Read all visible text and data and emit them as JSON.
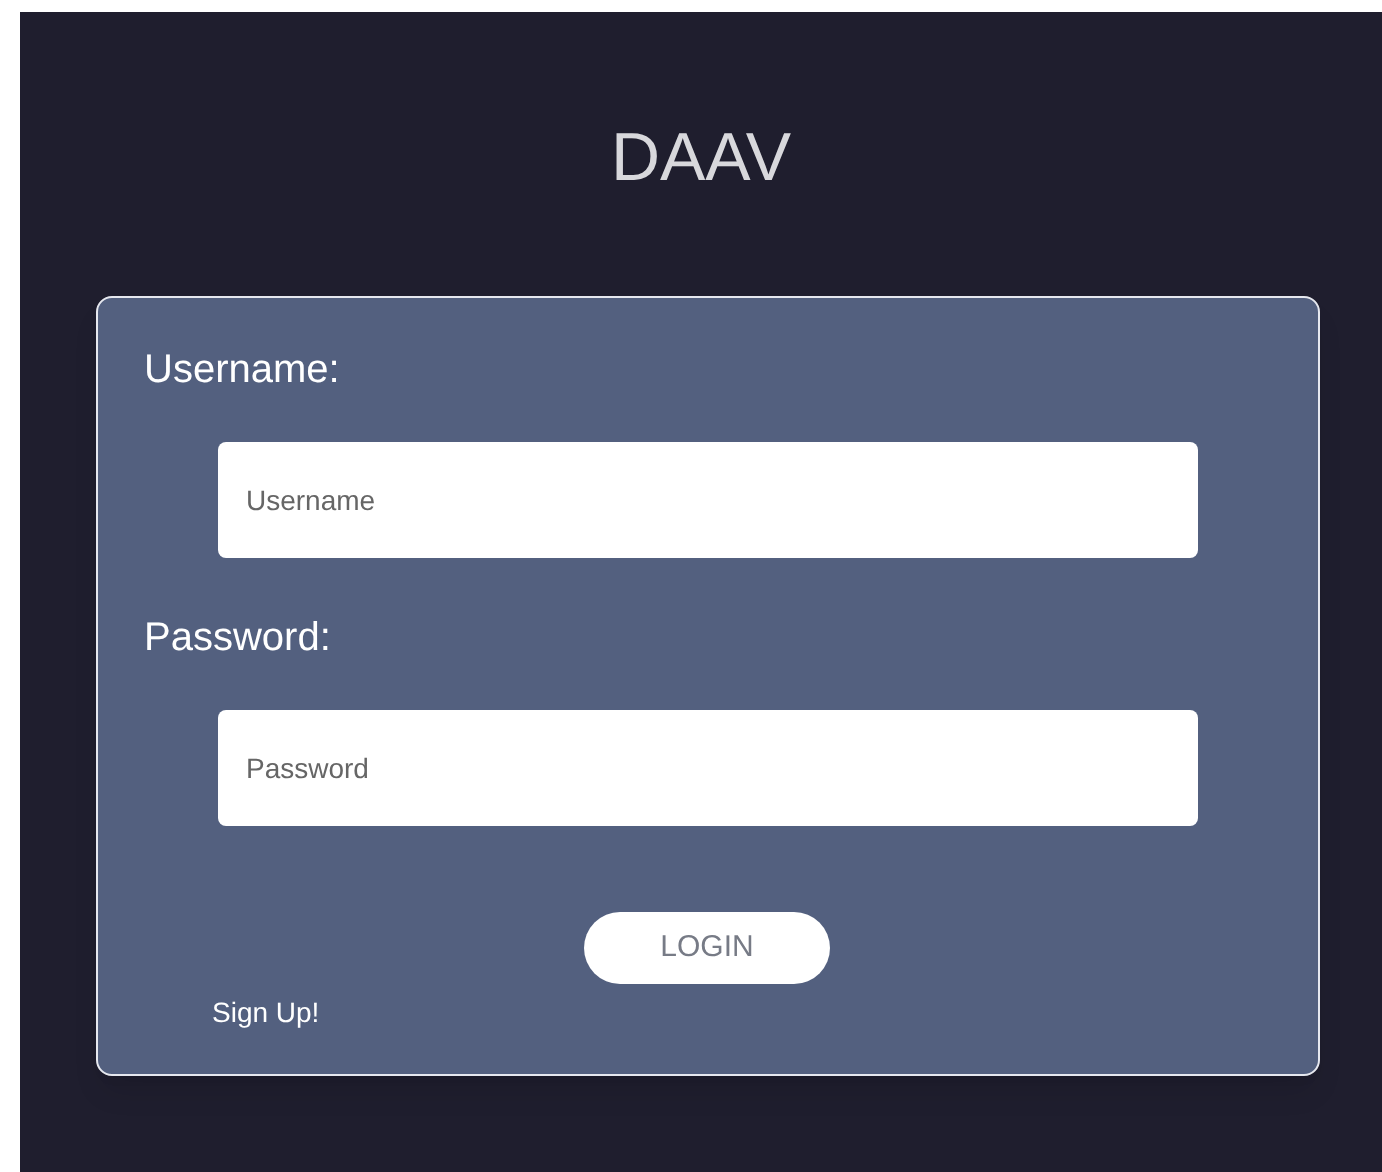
{
  "title": "DAAV",
  "fields": [
    {
      "label": "Username:",
      "placeholder": "Username"
    },
    {
      "label": "Password:",
      "placeholder": "Password"
    }
  ],
  "login_button": "LOGIN",
  "signup_link": "Sign Up!"
}
